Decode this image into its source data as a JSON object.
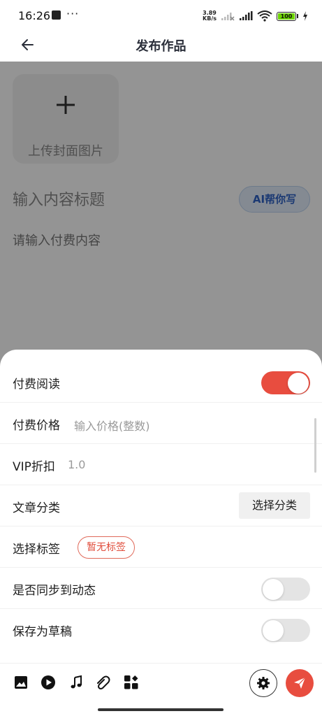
{
  "status_bar": {
    "time": "16:26",
    "overflow_dots": "···",
    "speed_value": "3.89",
    "speed_unit": "KB/s",
    "battery": "100"
  },
  "header": {
    "title": "发布作品"
  },
  "form": {
    "upload_cover_label": "上传封面图片",
    "title_placeholder": "输入内容标题",
    "ai_write_label": "AI帮你写",
    "content_placeholder": "请输入付费内容"
  },
  "sheet": {
    "paid_reading": {
      "label": "付费阅读",
      "enabled": true
    },
    "paid_price": {
      "label": "付费价格",
      "placeholder": "输入价格(整数)"
    },
    "vip_discount": {
      "label": "VIP折扣",
      "value": "1.0"
    },
    "category": {
      "label": "文章分类",
      "button": "选择分类"
    },
    "tags": {
      "label": "选择标签",
      "chip": "暂无标签"
    },
    "sync_to_feed": {
      "label": "是否同步到动态",
      "enabled": false
    },
    "save_as_draft": {
      "label": "保存为草稿",
      "enabled": false
    }
  },
  "toolbar": {
    "icons": [
      "image-icon",
      "play-icon",
      "music-note-icon",
      "paperclip-icon",
      "apps-icon",
      "gear-icon",
      "send-icon"
    ]
  },
  "colors": {
    "accent": "#e84d3f",
    "ai_button_text": "#2f63c6",
    "toggle_off": "#e4e4e4"
  }
}
